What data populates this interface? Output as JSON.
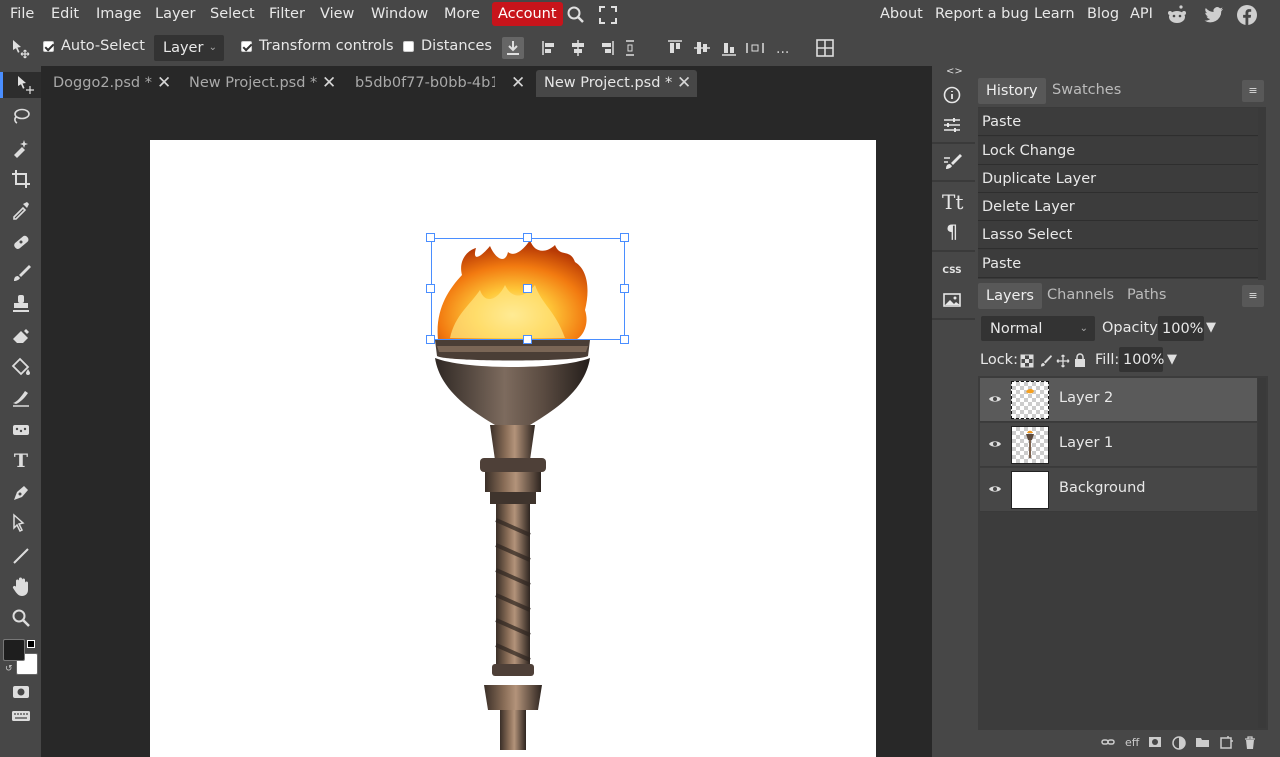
{
  "menubar": {
    "left": [
      "File",
      "Edit",
      "Image",
      "Layer",
      "Select",
      "Filter",
      "View",
      "Window",
      "More"
    ],
    "account": "Account",
    "right": [
      "About",
      "Report a bug",
      "Learn",
      "Blog",
      "API"
    ]
  },
  "options": {
    "auto_select": "Auto-Select",
    "layer_mode": "Layer",
    "transform_controls": "Transform controls",
    "distances": "Distances",
    "more": "..."
  },
  "tabs": [
    {
      "label": "Doggo2.psd *"
    },
    {
      "label": "New Project.psd *"
    },
    {
      "label": "b5db0f77-b0bb-4b1 *"
    },
    {
      "label": "New Project.psd *"
    }
  ],
  "panel": {
    "collapse_left": "<>",
    "collapse_right": "><",
    "history_tab": "History",
    "swatches_tab": "Swatches",
    "history": [
      "Paste",
      "Lock Change",
      "Duplicate Layer",
      "Delete Layer",
      "Lasso Select",
      "Paste"
    ],
    "layers_tab": "Layers",
    "channels_tab": "Channels",
    "paths_tab": "Paths",
    "blend_mode": "Normal",
    "opacity_label": "Opacity:",
    "opacity_value": "100%",
    "lock_label": "Lock:",
    "fill_label": "Fill:",
    "fill_value": "100%",
    "layers": [
      {
        "name": "Layer 2"
      },
      {
        "name": "Layer 1"
      },
      {
        "name": "Background"
      }
    ],
    "css_label": "CSS",
    "eff_label": "eff"
  },
  "colors": {
    "account_bg": "#c8141b",
    "selection": "#4a8eff",
    "foreground": "#1e1e1e",
    "background": "#ffffff"
  }
}
